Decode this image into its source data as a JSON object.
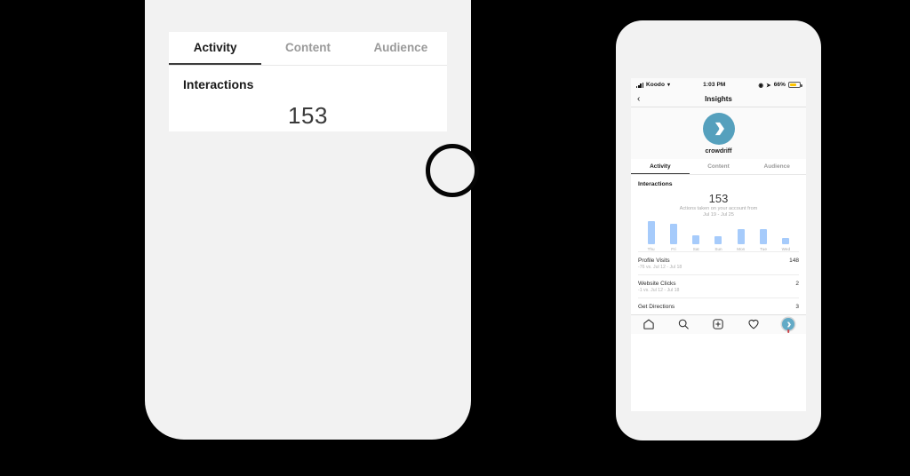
{
  "app": {
    "screen_title": "Insights",
    "back_icon": "chevron-left-icon"
  },
  "status_bar": {
    "carrier": "Koodo",
    "time": "1:03 PM",
    "battery_percent": "66%",
    "battery_level": 66,
    "battery_color": "#fdc500",
    "signal_icon": "signal-bars-icon",
    "wifi_icon": "wifi-icon",
    "location_icon": "location-arrow-icon",
    "alarm_icon": "alarm-icon"
  },
  "profile": {
    "username": "crowdriff",
    "avatar_icon": "crowdriff-logo-icon",
    "avatar_color": "#55a0bd"
  },
  "tabs": [
    {
      "label": "Activity",
      "active": true
    },
    {
      "label": "Content",
      "active": false
    },
    {
      "label": "Audience",
      "active": false
    }
  ],
  "insights": {
    "section_title": "Interactions",
    "total": "153",
    "caption_line1": "Actions taken on your account from",
    "caption_line2": "Jul 19 - Jul 25"
  },
  "chart_data": {
    "type": "bar",
    "title": "Interactions",
    "categories": [
      "Thu",
      "Fri",
      "Sat",
      "Sun",
      "Mon",
      "Tue",
      "Wed"
    ],
    "values": [
      44,
      38,
      16,
      14,
      28,
      29,
      11
    ],
    "bar_color": "#a6cbfb",
    "xlabel": "",
    "ylabel": "",
    "ylim": [
      0,
      48
    ],
    "grid": false,
    "legend": "none"
  },
  "stats": [
    {
      "name": "Profile Visits",
      "delta": "-76 vs. Jul 12 - Jul 18",
      "value": "148"
    },
    {
      "name": "Website Clicks",
      "delta": "-1 vs. Jul 12 - Jul 18",
      "value": "2"
    },
    {
      "name": "Get Directions",
      "delta": "",
      "value": "3"
    }
  ],
  "tabbar": [
    {
      "name": "home",
      "icon": "home-icon"
    },
    {
      "name": "search",
      "icon": "search-icon"
    },
    {
      "name": "add-post",
      "icon": "plus-square-icon"
    },
    {
      "name": "activity",
      "icon": "heart-icon"
    },
    {
      "name": "profile",
      "icon": "profile-pin-icon"
    }
  ]
}
